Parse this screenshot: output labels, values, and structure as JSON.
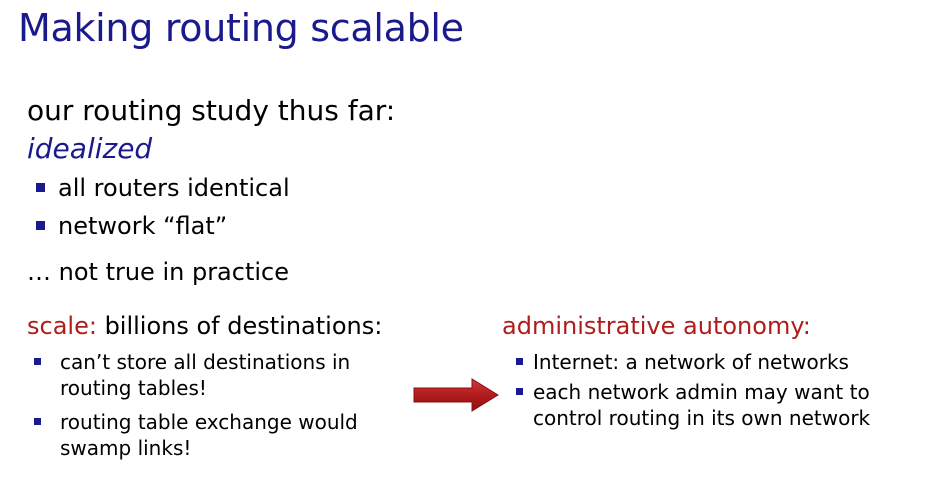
{
  "slide": {
    "title": "Making routing scalable",
    "intro": "our routing study thus far:",
    "idealized": "idealized",
    "idealized_points": [
      "all routers identical",
      "network “flat”"
    ],
    "not_true": "… not true in practice",
    "scale": {
      "label": "scale:",
      "heading_rest": " billions of destinations:",
      "points": [
        "can’t store all destinations in routing tables!",
        "routing table exchange would swamp links!"
      ]
    },
    "autonomy": {
      "heading": "administrative autonomy:",
      "points": [
        "Internet: a network of networks",
        "each network admin may want to control routing in its own network"
      ]
    }
  },
  "colors": {
    "title": "#1a1a8c",
    "accent_red": "#b01c1c",
    "bullet": "#1a1a8c",
    "arrow": "#b01c1c"
  },
  "icons": {
    "bullet": "square-bullet-icon",
    "arrow": "right-arrow-icon"
  }
}
